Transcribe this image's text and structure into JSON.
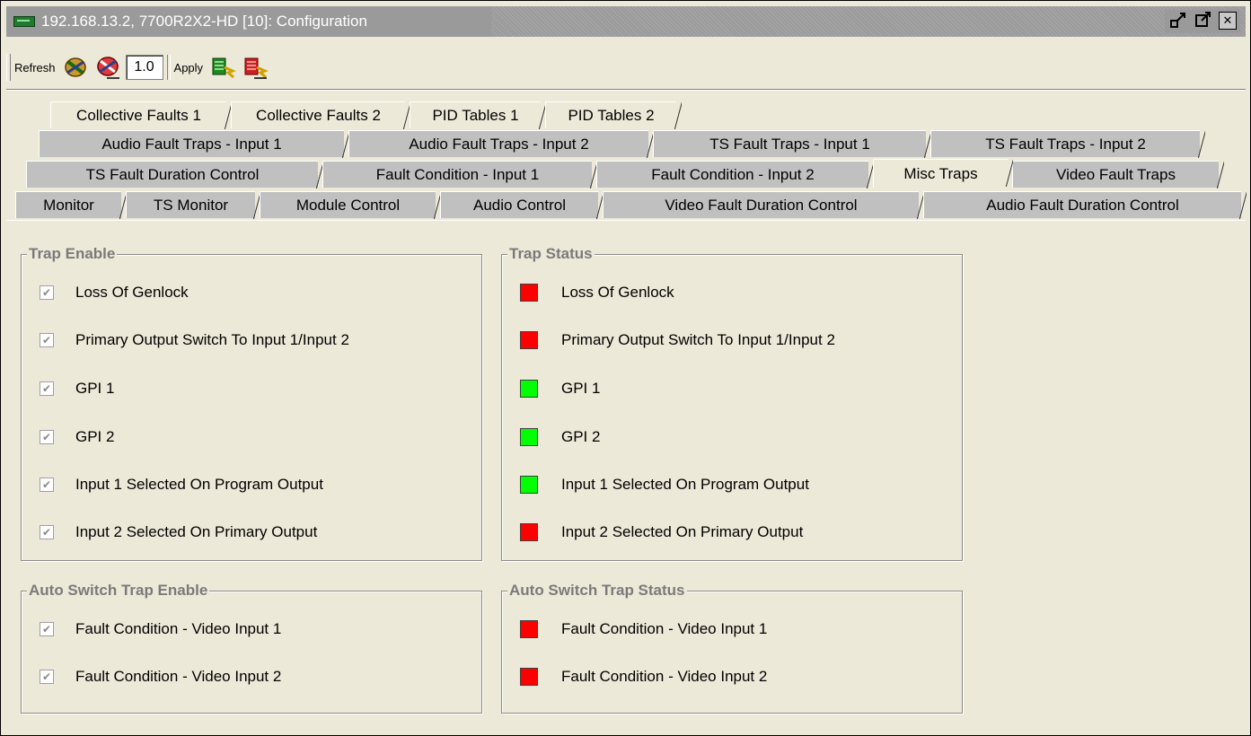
{
  "window": {
    "title": "192.168.13.2, 7700R2X2-HD  [10]: Configuration"
  },
  "toolbar": {
    "refresh_label": "Refresh",
    "interval_value": "1.0",
    "apply_label": "Apply"
  },
  "tabs": {
    "row1": [
      "Collective Faults 1",
      "Collective Faults 2",
      "PID Tables 1",
      "PID Tables 2"
    ],
    "row2": [
      "Audio Fault Traps - Input 1",
      "Audio Fault Traps - Input 2",
      "TS Fault Traps - Input 1",
      "TS Fault Traps - Input 2"
    ],
    "row3": [
      "TS Fault Duration Control",
      "Fault Condition - Input 1",
      "Fault Condition - Input 2",
      "Misc Traps",
      "Video Fault Traps"
    ],
    "row4": [
      "Monitor",
      "TS Monitor",
      "Module Control",
      "Audio Control",
      "Video Fault Duration Control",
      "Audio Fault Duration Control"
    ],
    "selected": "Misc Traps"
  },
  "trap_enable": {
    "title": "Trap Enable",
    "items": [
      {
        "label": "Loss Of Genlock",
        "checked": true
      },
      {
        "label": "Primary Output Switch To Input 1/Input 2",
        "checked": true
      },
      {
        "label": "GPI 1",
        "checked": true
      },
      {
        "label": "GPI 2",
        "checked": true
      },
      {
        "label": "Input 1 Selected On Program Output",
        "checked": true
      },
      {
        "label": "Input 2 Selected On Primary Output",
        "checked": true
      }
    ]
  },
  "trap_status": {
    "title": "Trap Status",
    "items": [
      {
        "label": "Loss Of Genlock",
        "color": "#ff0000"
      },
      {
        "label": "Primary Output Switch To Input 1/Input 2",
        "color": "#ff0000"
      },
      {
        "label": "GPI 1",
        "color": "#00ff00"
      },
      {
        "label": "GPI 2",
        "color": "#00ff00"
      },
      {
        "label": "Input 1 Selected On Program Output",
        "color": "#00ff00"
      },
      {
        "label": "Input 2 Selected On Primary Output",
        "color": "#ff0000"
      }
    ]
  },
  "auto_switch_enable": {
    "title": "Auto Switch Trap Enable",
    "items": [
      {
        "label": "Fault Condition - Video Input 1",
        "checked": true
      },
      {
        "label": "Fault Condition - Video Input 2",
        "checked": true
      }
    ]
  },
  "auto_switch_status": {
    "title": "Auto Switch Trap Status",
    "items": [
      {
        "label": "Fault Condition - Video Input 1",
        "color": "#ff0000"
      },
      {
        "label": "Fault Condition - Video Input 2",
        "color": "#ff0000"
      }
    ]
  },
  "icons": {
    "app": "module-card-icon",
    "refresh": "refresh-icon",
    "auto_refresh": "auto-refresh-icon",
    "apply": "apply-icon",
    "auto_apply": "auto-apply-icon"
  }
}
